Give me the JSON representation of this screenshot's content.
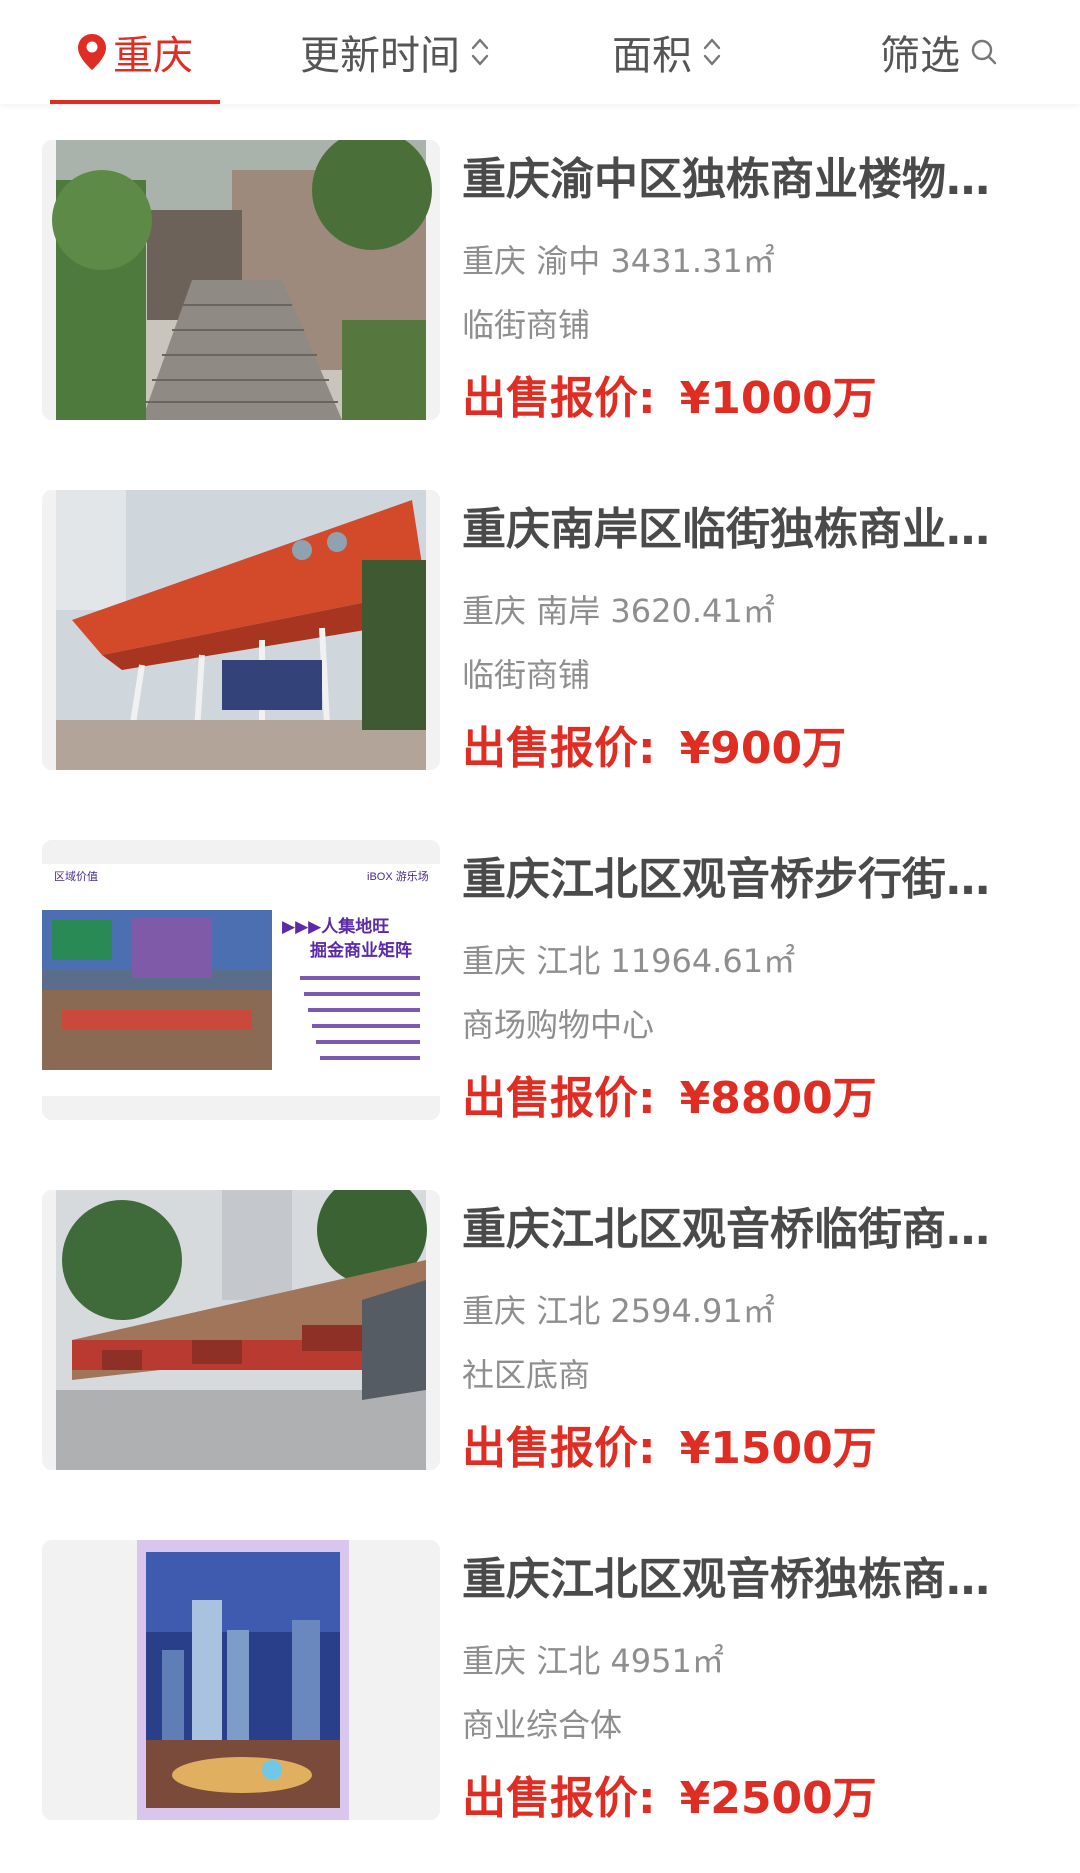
{
  "filter_bar": {
    "city": "重庆",
    "update_time": "更新时间",
    "area": "面积",
    "filter": "筛选"
  },
  "colors": {
    "accent": "#e02d23",
    "title": "#4a4a4a",
    "meta": "#8e8e8e"
  },
  "listings": [
    {
      "title": "重庆渝中区独栋商业楼物…",
      "city": "重庆",
      "district": "渝中",
      "area": "3431.31㎡",
      "type": "临街商铺",
      "price_label": "出售报价:",
      "price": "¥1000万",
      "image": "stairs-building-photo"
    },
    {
      "title": "重庆南岸区临街独栋商业…",
      "city": "重庆",
      "district": "南岸",
      "area": "3620.41㎡",
      "type": "临街商铺",
      "price_label": "出售报价:",
      "price": "¥900万",
      "image": "red-building-photo"
    },
    {
      "title": "重庆江北区观音桥步行街…",
      "city": "重庆",
      "district": "江北",
      "area": "11964.61㎡",
      "type": "商场购物中心",
      "price_label": "出售报价:",
      "price": "¥8800万",
      "image": "brochure-slide",
      "image_texts": {
        "tag": "区域价值",
        "brand": "iBOX 游乐场",
        "headline1": "▶▶▶人集地旺",
        "headline2": "掘金商业矩阵"
      }
    },
    {
      "title": "重庆江北区观音桥临街商…",
      "city": "重庆",
      "district": "江北",
      "area": "2594.91㎡",
      "type": "社区底商",
      "price_label": "出售报价:",
      "price": "¥1500万",
      "image": "street-shops-photo"
    },
    {
      "title": "重庆江北区观音桥独栋商…",
      "city": "重庆",
      "district": "江北",
      "area": "4951㎡",
      "type": "商业综合体",
      "price_label": "出售报价:",
      "price": "¥2500万",
      "image": "city-night-rendering"
    }
  ]
}
